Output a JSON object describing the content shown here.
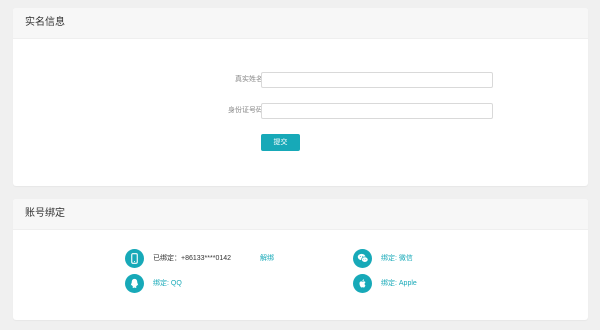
{
  "colors": {
    "accent": "#17a9b8",
    "background": "#f0f0f0"
  },
  "realname": {
    "title": "实名信息",
    "name_label": "真实姓名",
    "name_value": "",
    "id_label": "身份证号码",
    "id_value": "",
    "submit_label": "提交"
  },
  "binding": {
    "title": "账号绑定",
    "phone": {
      "icon": "phone-icon",
      "status": "已绑定：+86133****0142",
      "action": "解绑"
    },
    "wechat": {
      "icon": "wechat-icon",
      "label": "绑定: 微信"
    },
    "qq": {
      "icon": "qq-icon",
      "label": "绑定: QQ"
    },
    "apple": {
      "icon": "apple-icon",
      "label": "绑定: Apple"
    }
  }
}
